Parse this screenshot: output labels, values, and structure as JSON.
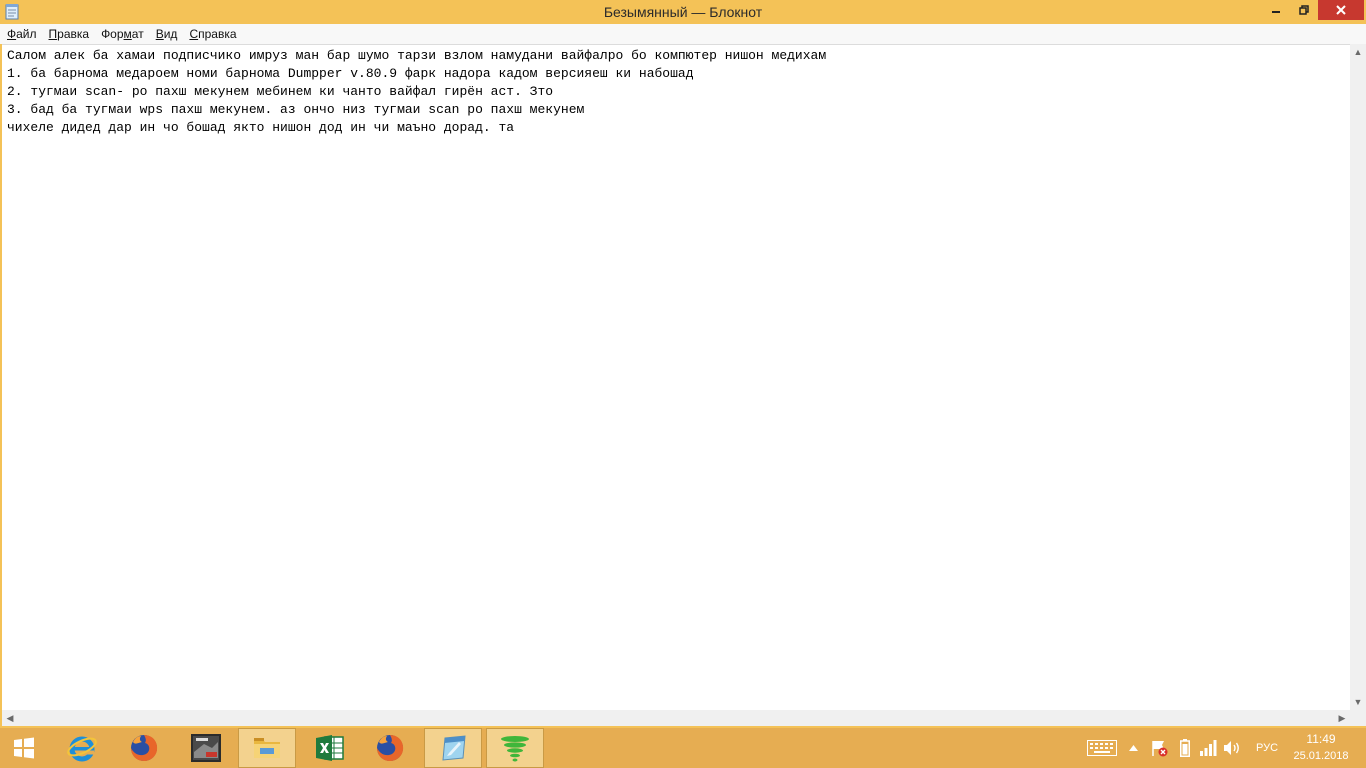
{
  "window": {
    "title": "Безымянный — Блокнот"
  },
  "menu": {
    "items": [
      {
        "pre": "",
        "acc": "Ф",
        "post": "айл"
      },
      {
        "pre": "",
        "acc": "П",
        "post": "равка"
      },
      {
        "pre": "Фор",
        "acc": "м",
        "post": "ат"
      },
      {
        "pre": "",
        "acc": "В",
        "post": "ид"
      },
      {
        "pre": "",
        "acc": "С",
        "post": "правка"
      }
    ]
  },
  "editor": {
    "lines": [
      "Салом алек ба хамаи подписчико имруз ман бар шумо тарзи взлом намудани вайфалро бо компютер нишон медихам",
      "1. ба барнома медароем номи барнома Dumpper v.80.9 фарк надора кадом версияеш ки набошад",
      "2. тугмаи scan- ро пахш мекунем мебинем ки чанто вайфал гирён аст. Зто",
      "3. бад ба тугмаи wps пахш мекунем. аз ончо низ тугмаи scan ро пахш мекунем",
      "чихеле дидед дар ин чо бошад якто нишон дод ин чи маъно дорад. та"
    ]
  },
  "taskbar": {
    "language": "РУС",
    "time": "11:49",
    "date": "25.01.2018",
    "icons": [
      "windows-start-icon",
      "internet-explorer-icon",
      "firefox-icon",
      "game-app-icon",
      "file-explorer-icon",
      "excel-icon",
      "firefox-icon",
      "notepad-icon",
      "wifi-signal-icon"
    ]
  },
  "colors": {
    "titlebar": "#f4c257",
    "taskbar": "#e6ad52",
    "close_button": "#c7382f"
  }
}
